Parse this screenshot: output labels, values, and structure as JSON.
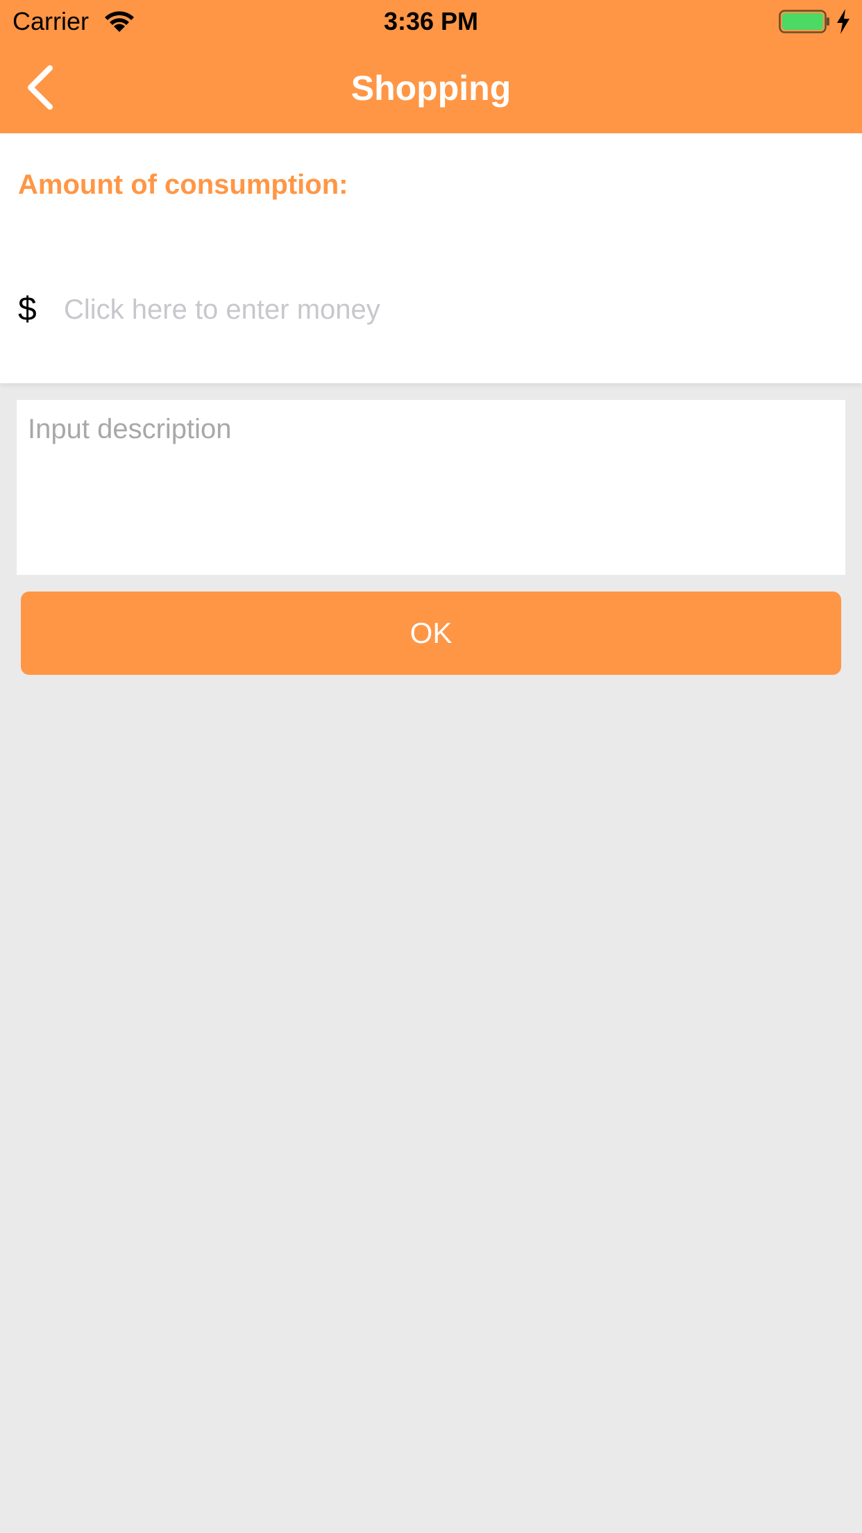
{
  "status_bar": {
    "carrier": "Carrier",
    "time": "3:36 PM",
    "icons": [
      "wifi-icon",
      "battery-icon",
      "charging-bolt-icon"
    ],
    "battery_color": "#4CD964"
  },
  "nav": {
    "title": "Shopping",
    "back_icon": "chevron-left-icon"
  },
  "form": {
    "amount_label": "Amount of consumption:",
    "currency_symbol": "$",
    "amount_placeholder": "Click here to enter money",
    "amount_value": "",
    "description_placeholder": "Input description",
    "description_value": "",
    "ok_label": "OK"
  },
  "colors": {
    "accent": "#FF9645",
    "background": "#EAEAEA",
    "surface": "#FFFFFF"
  }
}
